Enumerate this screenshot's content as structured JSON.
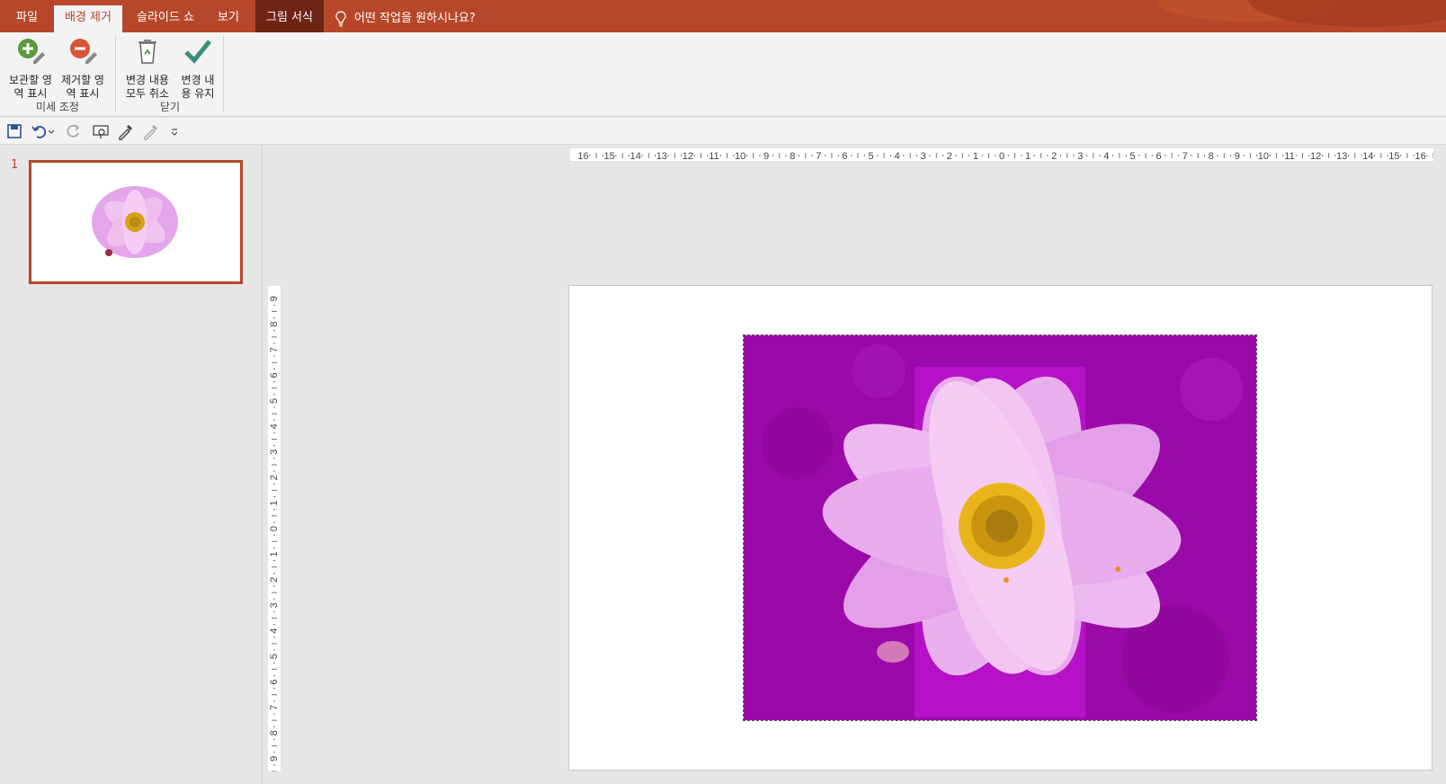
{
  "tabs": [
    {
      "label": "파일"
    },
    {
      "label": "배경 제거"
    },
    {
      "label": "슬라이드 쇼"
    },
    {
      "label": "보기"
    },
    {
      "label": "그림 서식"
    }
  ],
  "tell_me": {
    "label": "어떤 작업을 원하시나요?"
  },
  "ribbon": {
    "keep": {
      "line1": "보관할 영",
      "line2": "역 표시"
    },
    "remove": {
      "line1": "제거할 영",
      "line2": "역 표시"
    },
    "discard": {
      "line1": "변경 내용",
      "line2": "모두 취소"
    },
    "keepchanges": {
      "line1": "변경 내",
      "line2": "용 유지"
    },
    "group_refine": "미세 조정",
    "group_close": "닫기"
  },
  "qat_icons": [
    "save-icon",
    "undo-icon",
    "redo-icon",
    "present-icon",
    "eyedropper-icon",
    "eyedropper-disabled-icon",
    "more-icon"
  ],
  "thumbnails": [
    {
      "number": "1"
    }
  ],
  "hruler_labels": [
    "16",
    "15",
    "14",
    "13",
    "12",
    "11",
    "10",
    "9",
    "8",
    "7",
    "6",
    "5",
    "4",
    "3",
    "2",
    "1",
    "0",
    "1",
    "2",
    "3",
    "4",
    "5",
    "6",
    "7",
    "8",
    "9",
    "10",
    "11",
    "12",
    "13",
    "14",
    "15",
    "16"
  ],
  "vruler_labels": [
    "9",
    "8",
    "7",
    "6",
    "5",
    "4",
    "3",
    "2",
    "1",
    "0",
    "1",
    "2",
    "3",
    "4",
    "5",
    "6",
    "7",
    "8",
    "9"
  ],
  "colors": {
    "accent": "#b7472a",
    "removal_mask": "#9a0aa8",
    "petal": "#e9a2ea",
    "center": "#e8b41a"
  }
}
